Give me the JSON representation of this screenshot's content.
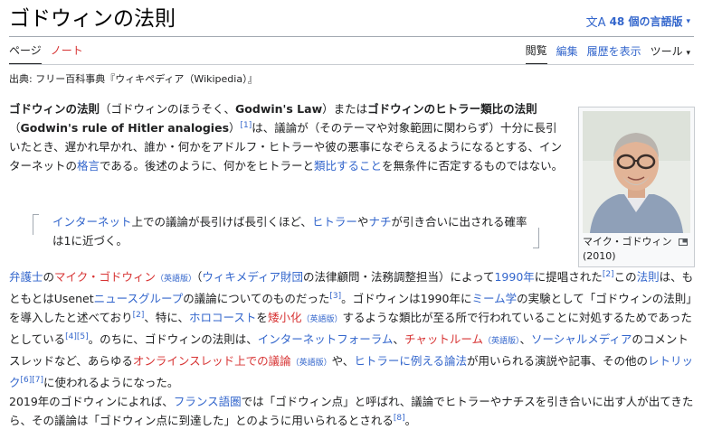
{
  "header": {
    "title": "ゴドウィンの法則",
    "lang_count": "48 個の言語版"
  },
  "tabs": {
    "page": "ページ",
    "talk": "ノート",
    "read": "閲覧",
    "edit": "編集",
    "history": "履歴を表示",
    "tools": "ツール"
  },
  "source": "出典: フリー百科事典『ウィキペディア（Wikipedia）』",
  "infobox": {
    "caption_line1": "マイク・ゴドウィン",
    "caption_line2": "(2010)"
  },
  "para1": {
    "t1": "ゴドウィンの法則",
    "t2": "（ゴドウィンのほうそく、",
    "t3": "Godwin's Law",
    "t4": "）または",
    "t5": "ゴドウィンのヒトラー類比の法則",
    "t6": "（",
    "t7": "Godwin's rule of Hitler analogies",
    "t8": "）",
    "ref1": "[1]",
    "t9": "は、議論が（そのテーマや対象範囲に関わらず）十分に長引いたとき、遅かれ早かれ、誰か・何かをアドルフ・ヒトラーや彼の悪事になぞらえるようになるとする、インターネットの",
    "link_kakugen": "格言",
    "t10": "である。後述のように、何かをヒトラーと",
    "link_ruihi": "類比すること",
    "t11": "を無条件に否定するものではない。"
  },
  "quote": {
    "link_internet": "インターネット",
    "q1": "上での議論が長引けば長引くほど、",
    "link_hitler": "ヒトラー",
    "q2": "や",
    "link_nazi": "ナチ",
    "q3": "が引き合いに出される確率は1に近づく。"
  },
  "para2": {
    "link_lawyer": "弁護士",
    "t1": "の",
    "link_godwin": "マイク・ゴドウィン",
    "en1": "（英語版）",
    "t2": "（",
    "link_wmf": "ウィキメディア財団",
    "t3": "の法律顧問・法務調整担当）によって",
    "link_1990": "1990年",
    "t4": "に提唱された",
    "ref2": "[2]",
    "t5": "この",
    "link_law": "法則",
    "t6": "は、もともとはUsenet",
    "link_newsgroup": "ニュースグループ",
    "t7": "の議論についてのものだった",
    "ref3": "[3]",
    "t8": "。ゴドウィンは1990年に",
    "link_meme": "ミーム学",
    "t9": "の実験として「ゴドウィンの法則」を導入したと述べており",
    "ref2b": "[2]",
    "t10": "、特に、",
    "link_holocaust": "ホロコースト",
    "t11": "を",
    "link_trivial": "矮小化",
    "en2": "（英語版）",
    "t12": "するような類比が至る所で行われていることに対処するためであったとしている",
    "ref45": "[4][5]",
    "t13": "。のちに、ゴドウィンの法則は、",
    "link_forum": "インターネットフォーラム",
    "t14": "、",
    "link_chat": "チャットルーム",
    "en3": "（英語版）",
    "t15": "、",
    "link_social": "ソーシャルメディア",
    "t16": "のコメントスレッドなど、あらゆる",
    "link_online": "オンラインスレッド上での議論",
    "en4": "（英語版）",
    "t17": "や、",
    "link_hitlerarg": "ヒトラーに例える論法",
    "t18": "が用いられる演説や記事、その他の",
    "link_rhetoric": "レトリック",
    "ref67": "[6][7]",
    "t19": "に使われるようになった。"
  },
  "para3": {
    "t1": "2019年のゴドウィンによれば、",
    "link_french": "フランス語圏",
    "t2": "では「ゴドウィン点」と呼ばれ、議論でヒトラーやナチスを引き合いに出す人が出てきたら、その議論は「ゴドウィン点に到達した」とのように用いられるとされる",
    "ref8": "[8]",
    "t3": "。"
  }
}
